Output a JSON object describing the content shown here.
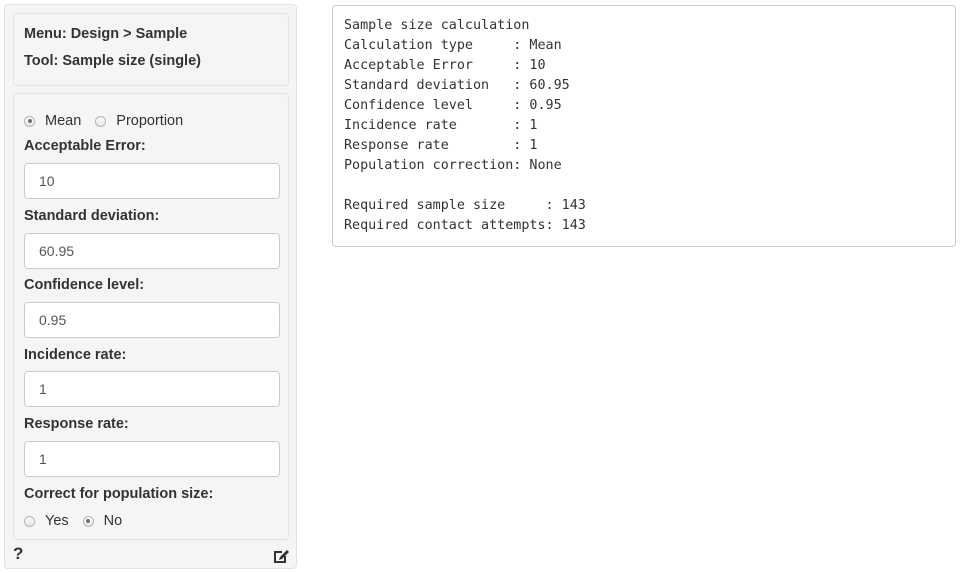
{
  "sidebar": {
    "menu_line": "Menu: Design > Sample",
    "tool_line": "Tool: Sample size (single)",
    "type_options": [
      {
        "label": "Mean",
        "checked": true
      },
      {
        "label": "Proportion",
        "checked": false
      }
    ],
    "fields": [
      {
        "label": "Acceptable Error:",
        "value": "10"
      },
      {
        "label": "Standard deviation:",
        "value": "60.95"
      },
      {
        "label": "Confidence level:",
        "value": "0.95"
      },
      {
        "label": "Incidence rate:",
        "value": "1"
      },
      {
        "label": "Response rate:",
        "value": "1"
      }
    ],
    "population_label": "Correct for population size:",
    "population_options": [
      {
        "label": "Yes",
        "checked": false
      },
      {
        "label": "No",
        "checked": true
      }
    ],
    "help_icon": "question-mark-icon",
    "edit_icon": "edit-icon",
    "help_glyph": "?"
  },
  "output": {
    "lines": [
      "Sample size calculation",
      "Calculation type     : Mean",
      "Acceptable Error     : 10",
      "Standard deviation   : 60.95",
      "Confidence level     : 0.95",
      "Incidence rate       : 1",
      "Response rate        : 1",
      "Population correction: None",
      "",
      "Required sample size     : 143",
      "Required contact attempts: 143"
    ]
  }
}
